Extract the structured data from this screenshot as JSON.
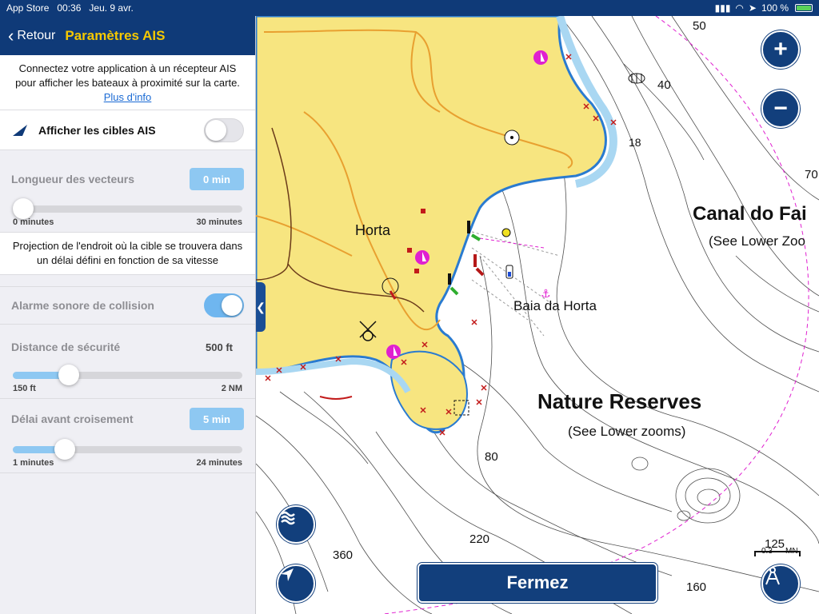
{
  "status": {
    "carrier": "App Store",
    "time": "00:36",
    "date": "Jeu. 9 avr.",
    "battery": "100 %"
  },
  "nav": {
    "back": "Retour",
    "title": "Paramètres AIS"
  },
  "intro": {
    "text": "Connectez votre application à un récepteur AIS pour afficher les bateaux à proximité sur la carte.",
    "link": "Plus d'info"
  },
  "ais_toggle": {
    "label": "Afficher les cibles AIS",
    "on": false
  },
  "vector": {
    "label": "Longueur des vecteurs",
    "value": "0 min",
    "min": "0 minutes",
    "max": "30 minutes",
    "fraction": 0.0
  },
  "vector_info": "Projection de l'endroit où la cible se trouvera dans un délai défini en fonction de sa vitesse",
  "collision": {
    "label": "Alarme sonore de collision",
    "on": true
  },
  "safety": {
    "label": "Distance de sécurité",
    "value": "500 ft",
    "min": "150 ft",
    "max": "2 NM",
    "fraction": 0.22
  },
  "crossing": {
    "label": "Délai avant croisement",
    "value": "5 min",
    "min": "1 minutes",
    "max": "24 minutes",
    "fraction": 0.2
  },
  "map": {
    "labels": {
      "horta": "Horta",
      "baia": "Baia da Horta",
      "canal": "Canal do Fai",
      "canal_sub": "(See Lower Zoo",
      "reserves": "Nature Reserves",
      "reserves_sub": "(See Lower zooms)",
      "d50": "50",
      "d40": "40",
      "d18": "18",
      "d70": "70",
      "d80": "80",
      "d220": "220",
      "d360": "360",
      "d160": "160",
      "d125": "125",
      "scale_value": "0.3",
      "scale_unit": "MN"
    },
    "zoom_in": "+",
    "zoom_out": "−",
    "close_button": "Fermez"
  },
  "colors": {
    "navy": "#0f3a78",
    "accent": "#f5c800",
    "land": "#f7e580",
    "shallow": "#a9d7f2",
    "toggle_on": "#6fb6ef"
  }
}
